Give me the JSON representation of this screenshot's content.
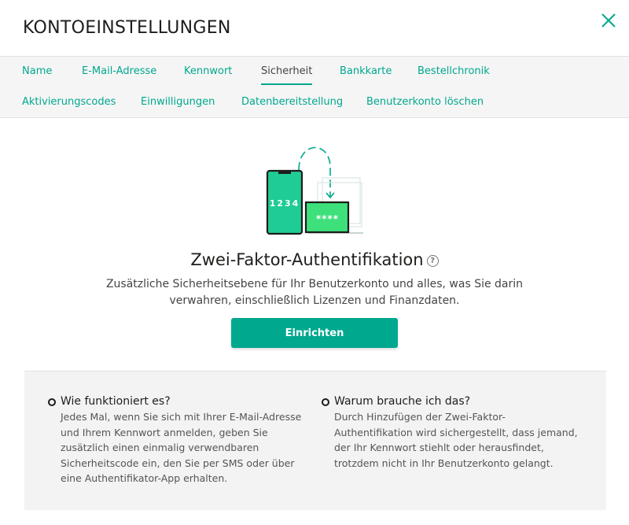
{
  "header": {
    "title": "KONTOEINSTELLUNGEN",
    "close_icon": "close-icon"
  },
  "tabs": {
    "row1": [
      {
        "label": "Name"
      },
      {
        "label": "E-Mail-Adresse"
      },
      {
        "label": "Kennwort"
      },
      {
        "label": "Sicherheit",
        "active": true
      },
      {
        "label": "Bankkarte"
      },
      {
        "label": "Bestellchronik"
      }
    ],
    "row2": [
      {
        "label": "Aktivierungscodes"
      },
      {
        "label": "Einwilligungen"
      },
      {
        "label": "Datenbereitstellung"
      },
      {
        "label": "Benutzerkonto löschen"
      }
    ]
  },
  "hero": {
    "phone_code": "1234",
    "monitor_code": "****",
    "title": "Zwei-Faktor-Authentifikation",
    "help_icon": "?",
    "description_line1": "Zusätzliche Sicherheitsebene für Ihr Benutzerkonto und alles, was Sie darin",
    "description_line2": "verwahren, einschließlich Lizenzen und Finanzdaten.",
    "button_label": "Einrichten"
  },
  "info": {
    "how": {
      "heading": "Wie funktioniert es?",
      "text": "Jedes Mal, wenn Sie sich mit Ihrer E-Mail-Adresse und Ihrem Kennwort anmelden, geben Sie zusätzlich einen einmalig verwendbaren Sicherheitscode ein, den Sie per SMS oder über eine Authentifikator-App erhalten."
    },
    "why": {
      "heading": "Warum brauche ich das?",
      "text": "Durch Hinzufügen der Zwei-Faktor-Authentifikation wird sichergestellt, dass jemand, der Ihr Kennwort stiehlt oder herausfindet, trotzdem nicht in Ihr Benutzerkonto gelangt."
    }
  },
  "colors": {
    "accent": "#00a88e",
    "accent_light": "#3ee07c",
    "text": "#1d1d1b"
  }
}
